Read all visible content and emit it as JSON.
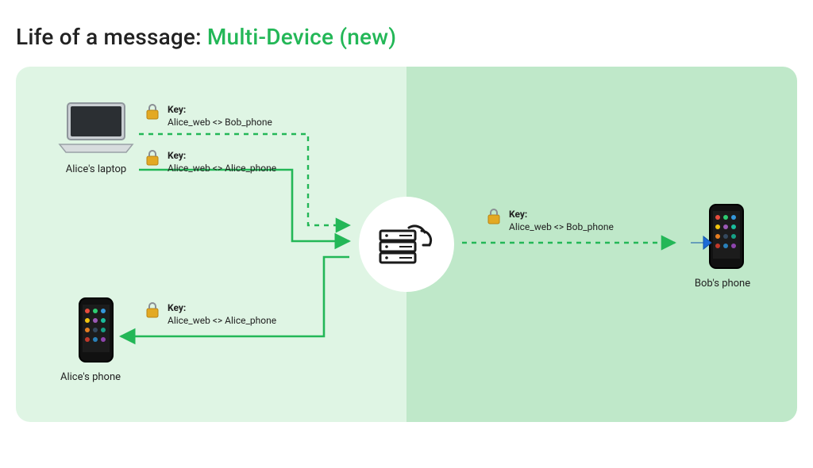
{
  "heading": {
    "prefix": "Life of a message: ",
    "accent": "Multi-Device (new)"
  },
  "devices": {
    "alice_laptop": {
      "label": "Alice's laptop"
    },
    "alice_phone": {
      "label": "Alice's phone"
    },
    "bob_phone": {
      "label": "Bob's phone"
    }
  },
  "keys": {
    "k1": {
      "title": "Key:",
      "pair": "Alice_web <> Bob_phone"
    },
    "k2": {
      "title": "Key:",
      "pair": "Alice_web <> Alice_phone"
    },
    "k3": {
      "title": "Key:",
      "pair": "Alice_web <> Alice_phone"
    },
    "k4": {
      "title": "Key:",
      "pair": "Alice_web <> Bob_phone"
    }
  },
  "icons": {
    "lock": "lock-icon",
    "server": "server-cloud-icon",
    "laptop": "laptop-icon",
    "phone": "phone-icon",
    "arrow_right": "arrow-right-icon"
  },
  "flows": {
    "alice_laptop_to_server_bob_key": {
      "from": "alice_laptop",
      "to": "server",
      "style": "dashed",
      "color": "#23b757"
    },
    "alice_laptop_to_server_alice_key": {
      "from": "alice_laptop",
      "to": "server",
      "style": "solid",
      "color": "#23b757"
    },
    "server_to_alice_phone": {
      "from": "server",
      "to": "alice_phone",
      "style": "solid",
      "color": "#23b757"
    },
    "server_to_bob_phone": {
      "from": "server",
      "to": "bob_phone",
      "style": "dashed",
      "color": "#23b757"
    }
  },
  "colors": {
    "accent": "#23b757",
    "bg_left": "#dff5e4",
    "bg_right": "#bfe8c9",
    "arrow_blue": "#1e6bd6"
  }
}
